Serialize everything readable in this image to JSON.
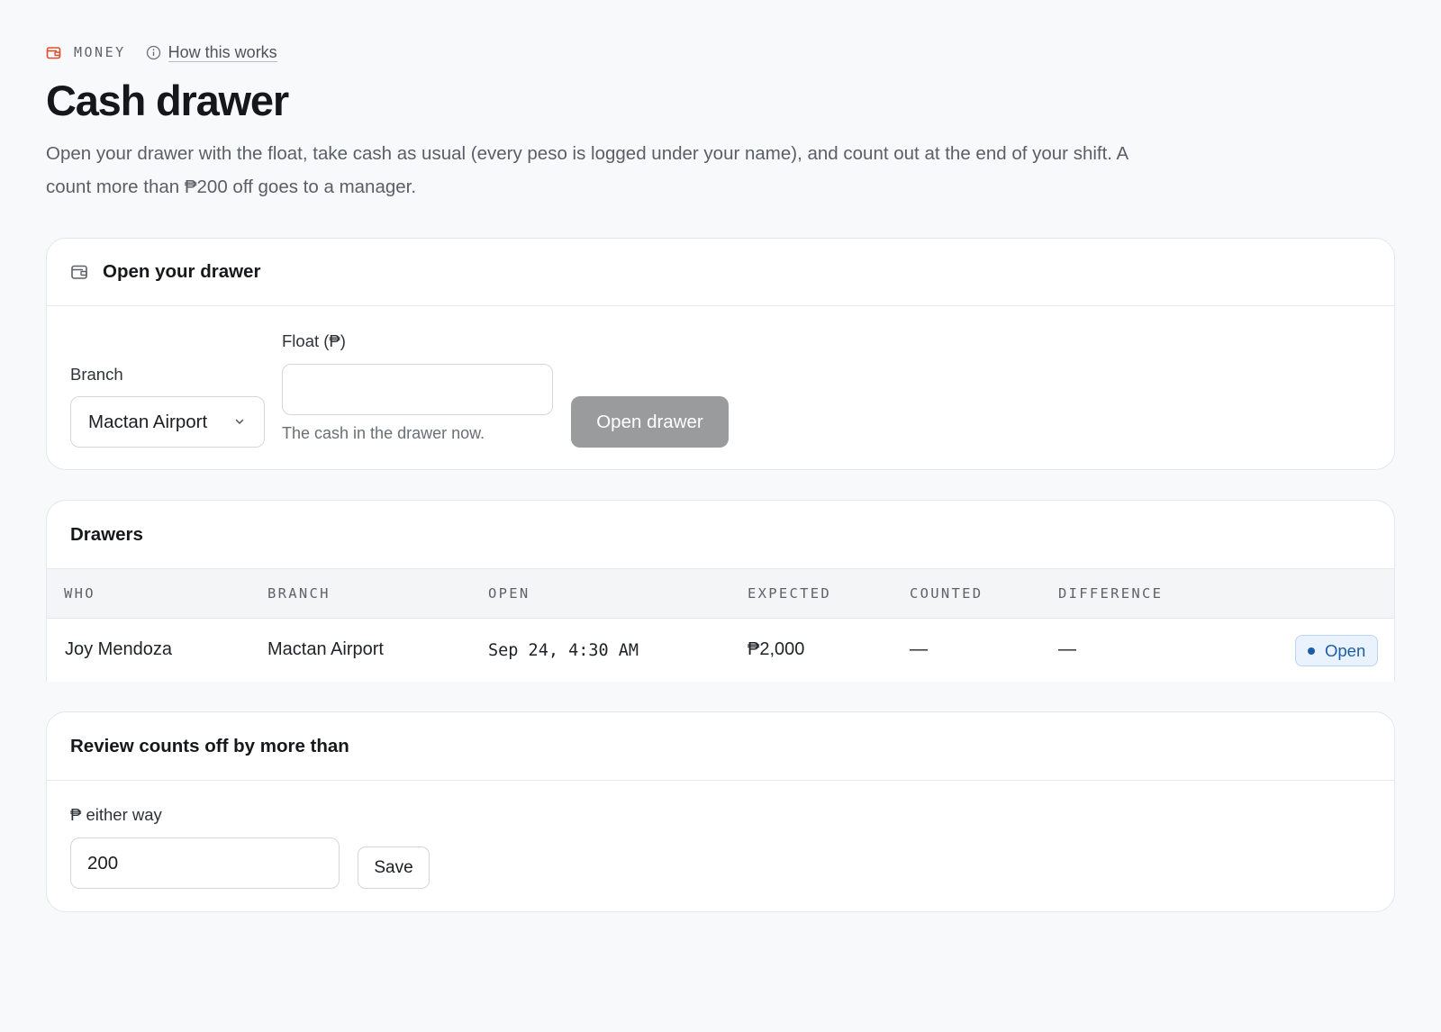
{
  "header": {
    "section_label": "MONEY",
    "how_link": "How this works",
    "title": "Cash drawer",
    "description": "Open your drawer with the float, take cash as usual (every peso is logged under your name), and count out at the end of your shift. A count more than ₱200 off goes to a manager.",
    "section_icon": "wallet-icon",
    "how_icon": "info-icon"
  },
  "open_drawer": {
    "title": "Open your drawer",
    "icon": "wallet-icon",
    "branch_label": "Branch",
    "branch_value": "Mactan Airport",
    "float_label": "Float (₱)",
    "float_value": "",
    "float_hint": "The cash in the drawer now.",
    "submit_label": "Open drawer"
  },
  "drawers": {
    "title": "Drawers",
    "columns": [
      "WHO",
      "BRANCH",
      "OPEN",
      "EXPECTED",
      "COUNTED",
      "DIFFERENCE"
    ],
    "rows": [
      {
        "who": "Joy Mendoza",
        "branch": "Mactan Airport",
        "open": "Sep 24, 4:30 AM",
        "expected": "₱2,000",
        "counted": "—",
        "difference": "—",
        "status": "Open"
      }
    ]
  },
  "review": {
    "title": "Review counts off by more than",
    "field_label": "₱ either way",
    "threshold_value": "200",
    "save_label": "Save"
  },
  "colors": {
    "accent": "#d9502e",
    "disabled_button": "#9a9b9d",
    "status_open_bg": "#eaf3fd",
    "status_open_text": "#1b5ea8"
  }
}
